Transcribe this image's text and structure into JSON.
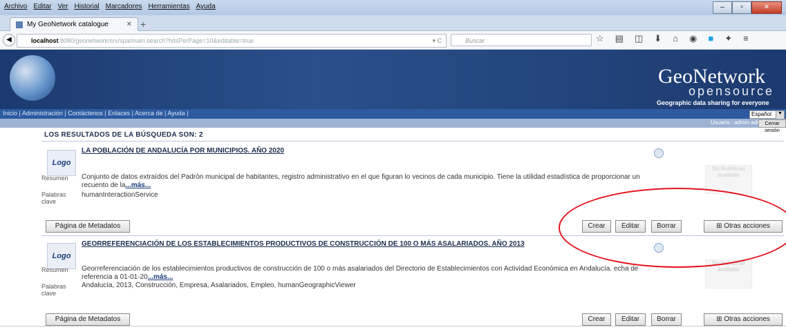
{
  "menubar": [
    "Archivo",
    "Editar",
    "Ver",
    "Historial",
    "Marcadores",
    "Herramientas",
    "Ayuda"
  ],
  "browser": {
    "tab_title": "My GeoNetwork catalogue",
    "url_host": "localhost",
    "url_rest": ":8080/geonetwork/srv/spa/main.search?hitsPerPage=10&editable=true",
    "search_placeholder": "Buscar"
  },
  "banner": {
    "logo_text": "GeoNetwork",
    "logo_sub": "opensource",
    "tagline": "Geographic data sharing for everyone"
  },
  "topnav": "Inicio | Administración | Contáctenos | Enlaces | Acerca de | Ayuda |",
  "language": "Español",
  "user": {
    "info": "Usuario : admin admin",
    "logout": "Cerrar sesión"
  },
  "results_title": "LOS RESULTADOS DE LA BÚSQUEDA SON:  2",
  "labels": {
    "logo": "Logo",
    "abstract": "Resumen",
    "keywords": "Palabras clave",
    "more": "...más...",
    "thumb": "No thumbnail available"
  },
  "buttons": {
    "metadata": "Página de Metadatos",
    "create": "Crear",
    "edit": "Editar",
    "delete": "Borrar",
    "other": "Otras acciones"
  },
  "records": [
    {
      "title": "LA POBLACIÓN DE ANDALUCÍA POR MUNICIPIOS. AÑO 2020",
      "abstract": "Conjunto de datos extraídos del Padrón municipal de habitantes, registro administrativo en el que figuran lo vecinos de cada municipio. Tiene la utilidad estadística de proporcionar un recuento de la",
      "keywords": "humanInteractionService"
    },
    {
      "title": "GEORREFERENCIACIÓN DE LOS ESTABLECIMIENTOS PRODUCTIVOS DE CONSTRUCCIÓN DE 100 O MÁS ASALARIADOS. AÑO 2013",
      "abstract": "Georreferenciación de los establecimientos productivos de construcción de 100 o más asalariados del Directorio de Establecimientos con Actividad Económica en Andalucía. echa de referencia a 01-01-20",
      "keywords": "Andalucía, 2013, Construcción, Empresa, Asalariados, Empleo, humanGeographicViewer"
    }
  ]
}
